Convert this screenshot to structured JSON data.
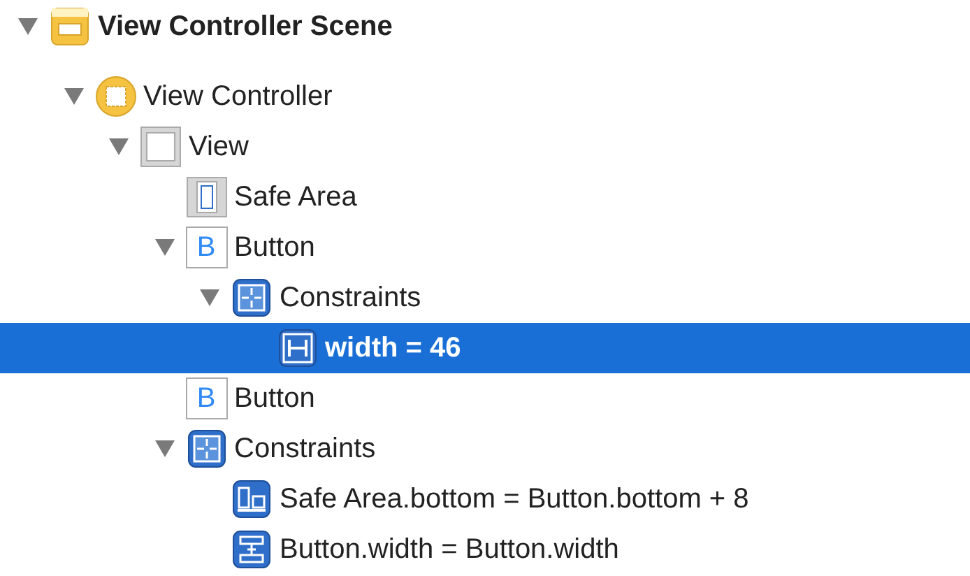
{
  "outline": [
    {
      "kind": "scene",
      "label": "View Controller Scene",
      "expanded": true,
      "selected": false,
      "children": [
        {
          "kind": "controller",
          "label": "View Controller",
          "expanded": true,
          "selected": false,
          "children": [
            {
              "kind": "view",
              "label": "View",
              "expanded": true,
              "selected": false,
              "children": [
                {
                  "kind": "safe_area",
                  "label": "Safe Area",
                  "selected": false
                },
                {
                  "kind": "button",
                  "icon_text": "B",
                  "label": "Button",
                  "expanded": true,
                  "selected": false,
                  "children": [
                    {
                      "kind": "constraints",
                      "label": "Constraints",
                      "expanded": true,
                      "selected": false,
                      "children": [
                        {
                          "kind": "width_constraint",
                          "label": "width = 46",
                          "selected": true
                        }
                      ]
                    }
                  ]
                },
                {
                  "kind": "button",
                  "icon_text": "B",
                  "label": "Button",
                  "selected": false
                },
                {
                  "kind": "constraints",
                  "label": "Constraints",
                  "expanded": true,
                  "selected": false,
                  "children": [
                    {
                      "kind": "align_constraint",
                      "label": "Safe Area.bottom = Button.bottom + 8",
                      "selected": false
                    },
                    {
                      "kind": "equal_width_constraint",
                      "label": "Button.width = Button.width",
                      "selected": false
                    }
                  ]
                }
              ]
            }
          ]
        }
      ]
    }
  ]
}
